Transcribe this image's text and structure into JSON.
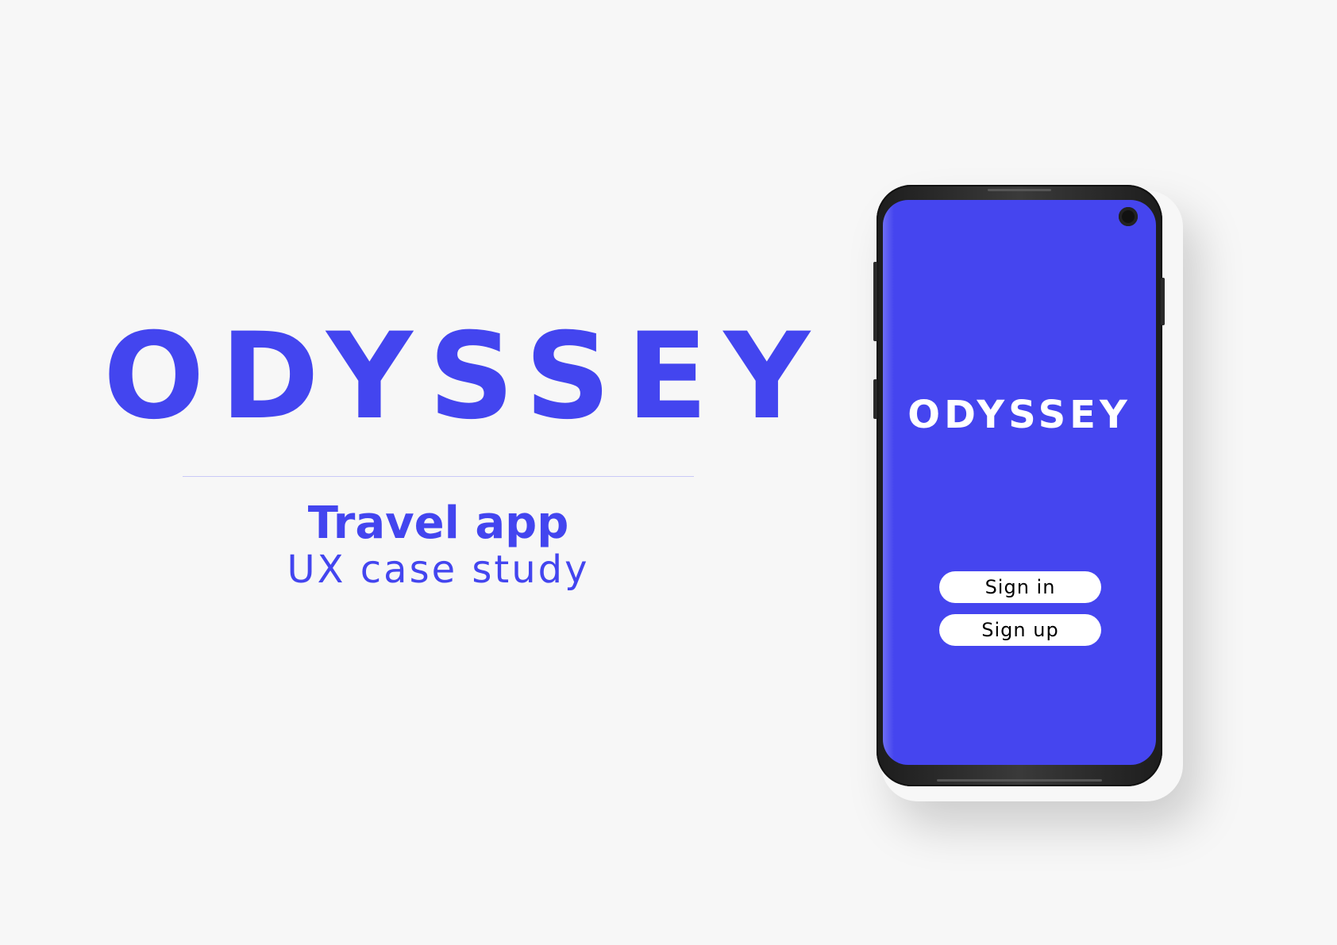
{
  "brand": {
    "title": "ODYSSEY",
    "subtitle": "Travel app",
    "caption": "UX case study",
    "accent_color": "#4345ef",
    "background_color": "#f7f7f7"
  },
  "phone": {
    "screen_color": "#4545ef",
    "app_title": "ODYSSEY",
    "buttons": {
      "sign_in_label": "Sign in",
      "sign_up_label": "Sign up"
    },
    "camera_icon": "front-camera-icon"
  }
}
